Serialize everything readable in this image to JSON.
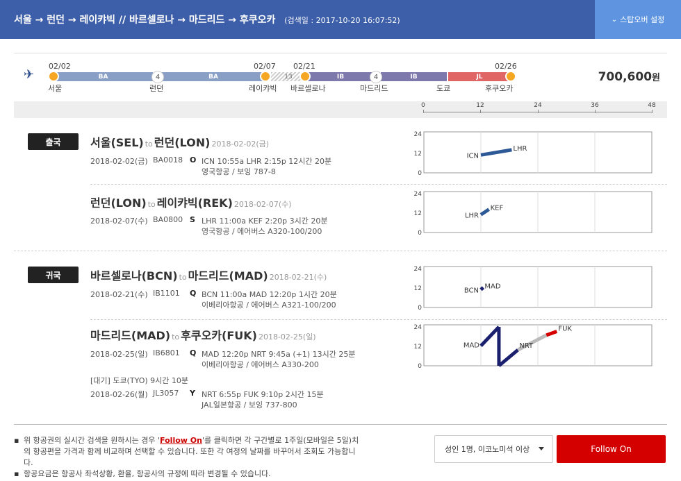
{
  "header": {
    "route": "서울 → 런던 → 레이캬빅 // 바르셀로나 → 마드리드 → 후쿠오카",
    "search_date": "(검색일 : 2017-10-20 16:07:52)",
    "stopover_label": "스탑오버 설정",
    "colors": {
      "bar": "#3d5ea8",
      "button": "#5f95e0"
    }
  },
  "summary": {
    "dates": [
      "02/02",
      "02/07",
      "02/21",
      "02/26"
    ],
    "cities": [
      "서울",
      "런던",
      "레이캬빅",
      "바르셀로나",
      "마드리드",
      "도쿄",
      "후쿠오카"
    ],
    "segments": [
      "BA",
      "BA",
      "IB",
      "IB",
      "JL"
    ],
    "stop_days": [
      "4",
      "13",
      "4"
    ],
    "price": "700,600",
    "currency": "원"
  },
  "scale": {
    "ticks": [
      "0",
      "12",
      "24",
      "36",
      "48"
    ]
  },
  "outbound": {
    "badge": "출국",
    "legs": [
      {
        "from": "서울(SEL)",
        "to_word": "to",
        "to": "런던(LON)",
        "date": "2018-02-02(금)",
        "flights": [
          {
            "date": "2018-02-02(금)",
            "flight_no": "BA0018",
            "class": "O",
            "times": "ICN 10:55a LHR 2:15p   12시간 20분",
            "airline": "영국항공 / 보잉 787-8"
          }
        ]
      },
      {
        "from": "런던(LON)",
        "to_word": "to",
        "to": "레이캬빅(REK)",
        "date": "2018-02-07(수)",
        "flights": [
          {
            "date": "2018-02-07(수)",
            "flight_no": "BA0800",
            "class": "S",
            "times": "LHR 11:00a KEF 2:20p   3시간 20분",
            "airline": "영국항공 / 에어버스 A320-100/200"
          }
        ]
      }
    ]
  },
  "inbound": {
    "badge": "귀국",
    "legs": [
      {
        "from": "바르셀로나(BCN)",
        "to_word": "to",
        "to": "마드리드(MAD)",
        "date": "2018-02-21(수)",
        "flights": [
          {
            "date": "2018-02-21(수)",
            "flight_no": "IB1101",
            "class": "Q",
            "times": "BCN 11:00a MAD 12:20p   1시간 20분",
            "airline": "이베리아항공 / 에어버스 A321-100/200"
          }
        ]
      },
      {
        "from": "마드리드(MAD)",
        "to_word": "to",
        "to": "후쿠오카(FUK)",
        "date": "2018-02-25(일)",
        "flights": [
          {
            "date": "2018-02-25(일)",
            "flight_no": "IB6801",
            "class": "Q",
            "times": "MAD 12:20p NRT 9:45a (+1)   13시간 25분",
            "airline": "이베리아항공 / 에어버스 A330-200"
          },
          {
            "date": "2018-02-26(월)",
            "flight_no": "JL3057",
            "class": "Y",
            "times": "NRT 6:55p FUK 9:10p   2시간 15분",
            "airline": "JAL일본항공 / 보잉 737-800"
          }
        ],
        "wait": "[대기] 도쿄(TYO)    9시간 10분"
      }
    ]
  },
  "charts": [
    {
      "y_ticks": [
        "24",
        "12",
        "0"
      ],
      "labels": [
        "ICN",
        "LHR"
      ],
      "points": [
        [
          0,
          11
        ],
        [
          6.5,
          14.2
        ]
      ],
      "color": "#2d5a96"
    },
    {
      "y_ticks": [
        "24",
        "12",
        "0"
      ],
      "labels": [
        "LHR",
        "KEF"
      ],
      "points": [
        [
          0,
          11
        ],
        [
          1.7,
          14.3
        ]
      ],
      "color": "#2d5a96"
    },
    {
      "y_ticks": [
        "24",
        "12",
        "0"
      ],
      "labels": [
        "BCN",
        "MAD"
      ],
      "points": [
        [
          0,
          11
        ],
        [
          0.5,
          12.3
        ]
      ],
      "color": "#1a1f6e"
    },
    {
      "y_ticks": [
        "24",
        "12",
        "0"
      ],
      "labels": [
        "MAD",
        "NRT",
        "FUK"
      ],
      "points": [
        [
          0,
          12.3
        ],
        [
          3.8,
          24
        ],
        [
          3.8,
          0
        ],
        [
          7.8,
          9.8
        ],
        [
          13.8,
          18.9
        ],
        [
          16,
          21.2
        ]
      ],
      "colors": [
        "#1a1f6e",
        "#bbbbbb",
        "#d40000"
      ]
    }
  ],
  "notes": {
    "line1_pre": "위 항공권의 실시간 검색을 원하시는 경우 '",
    "line1_link": "Follow On",
    "line1_post": "'를 클릭하면 각 구간별로 1주일(모바일은 5일)치의 항공편을 가격과 함께 비교하며 선택할 수 있습니다. 또한 각 여정의 날짜를 바꾸어서 조회도 가능합니다.",
    "line2": "항공요금은 항공사 좌석상황, 환율, 항공사의 규정에 따라 변경될 수 있습니다."
  },
  "controls": {
    "passenger_select": "성인 1명, 이코노미석 이상",
    "follow_on_button": "Follow On"
  }
}
